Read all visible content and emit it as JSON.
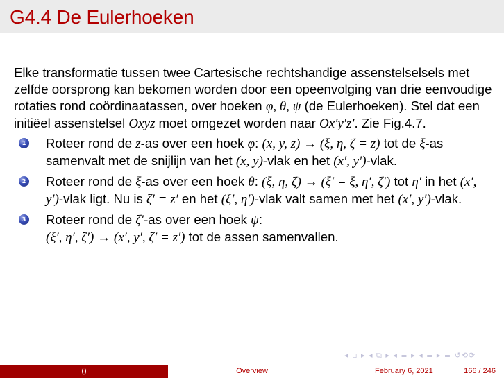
{
  "frame": {
    "title": "G4.4 De Eulerhoeken"
  },
  "intro": {
    "t1": "Elke transformatie tussen twee Cartesische rechtshandige assenstelselsels met zelfde oorsprong kan bekomen worden door een opeenvolging van drie eenvoudige rotaties rond coördinaatassen, over hoeken ",
    "angles": "φ, θ, ψ",
    "t2": " (de Eulerhoeken). Stel dat een initiëel assenstelsel ",
    "oxyz": "Oxyz",
    "t3": " moet omgezet worden naar ",
    "oxyz_prime": "Ox′y′z′",
    "t4": ". Zie Fig.4.7."
  },
  "steps": [
    {
      "num": "1",
      "a": "Roteer rond de ",
      "axis": "z",
      "b": "-as over een hoek ",
      "angle": "φ",
      "c": ":  ",
      "map": "(x, y, z) → (ξ, η, ζ = z)",
      "d": " tot de ",
      "xi": "ξ",
      "e": "-as samenvalt met de snijlijn van het ",
      "plane1": "(x, y)",
      "f": "-vlak en het ",
      "plane2": "(x′, y′)",
      "g": "-vlak."
    },
    {
      "num": "2",
      "a": "Roteer rond de ",
      "axis": "ξ",
      "b": "-as over een hoek ",
      "angle": "θ",
      "c": ":  ",
      "map": "(ξ, η, ζ) → (ξ′ = ξ, η′, ζ′)",
      "d": " tot ",
      "eta": "η′",
      "e": " in het ",
      "plane1": "(x′, y′)",
      "f": "-vlak ligt. Nu is ",
      "eq": "ζ′ = z′",
      "g": " en het ",
      "plane2": "(ξ′, η′)",
      "h": "-vlak valt samen met het ",
      "plane3": "(x′, y′)",
      "i": "-vlak."
    },
    {
      "num": "3",
      "a": "Roteer rond de ",
      "axis": "ζ′",
      "b": "-as over een hoek ",
      "angle": "ψ",
      "c": ": ",
      "map": "(ξ′, η′, ζ′) → (x′, y′, ζ′ = z′)",
      "d": " tot de assen samenvallen."
    }
  ],
  "nav": {
    "symbols": "◂ ▫ ▸  ◂ ⧉ ▸  ◂ ≡ ▸  ◂ ≡ ▸   ≡   ↺⟲⟳"
  },
  "footer": {
    "author": "()",
    "section": "Overview",
    "date": "February 6, 2021",
    "page": "166 / 246"
  }
}
